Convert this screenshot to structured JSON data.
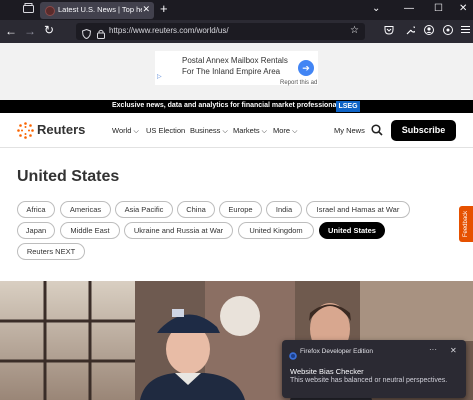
{
  "browser": {
    "tab_title": "Latest U.S. News | Top headlines",
    "tab_close": "✕",
    "new_tab": "+",
    "url": "https://www.reuters.com/world/us/",
    "window_controls": [
      "⌄",
      "—",
      "☐",
      "✕"
    ]
  },
  "ad": {
    "line1": "Postal Annex Mailbox Rentals",
    "line2": "For The Inland Empire Area",
    "report": "Report this ad"
  },
  "promo": {
    "text": "Exclusive news, data and analytics for financial market professionals",
    "brand": "LSEG"
  },
  "header": {
    "logo": "Reuters",
    "menu": [
      {
        "label": "World",
        "chevron": true
      },
      {
        "label": "US Election",
        "chevron": false
      },
      {
        "label": "Business",
        "chevron": true
      },
      {
        "label": "Markets",
        "chevron": true
      },
      {
        "label": "More",
        "chevron": true
      }
    ],
    "my_news": "My News",
    "subscribe": "Subscribe"
  },
  "page_title": "United States",
  "region_chips": [
    "Africa",
    "Americas",
    "Asia Pacific",
    "China",
    "Europe",
    "India",
    "Israel and Hamas at War",
    "Japan",
    "Middle East",
    "Ukraine and Russia at War",
    "United Kingdom",
    "United States",
    "Reuters NEXT"
  ],
  "active_chip": "United States",
  "feedback": "Feedback",
  "notification": {
    "app": "Firefox Developer Edition",
    "more": "···",
    "close": "✕",
    "title": "Website Bias Checker",
    "body": "This website has balanced or neutral perspectives."
  },
  "colors": {
    "brand_orange": "#fa6400",
    "accent_blue": "#0e63c6",
    "feedback": "#e65100"
  }
}
